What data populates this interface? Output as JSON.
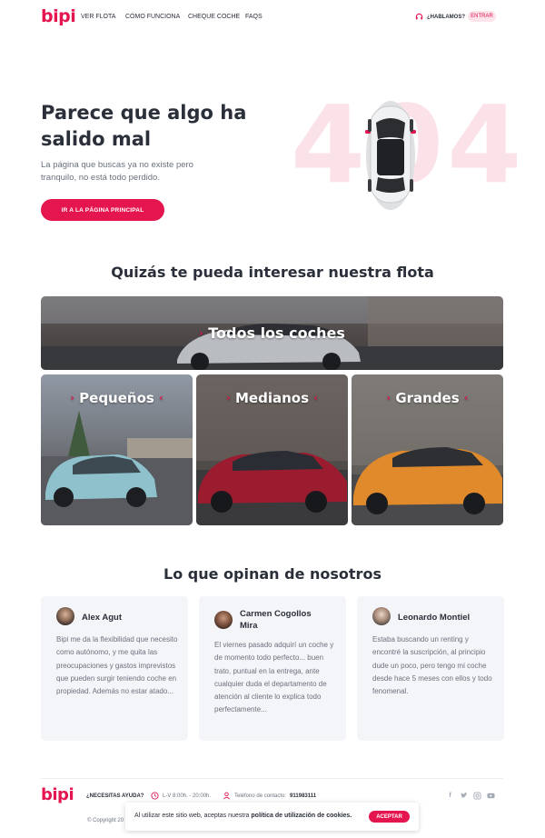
{
  "brand": {
    "logo": "bipi",
    "accent": "#e5154f",
    "accent_soft": "#fde3ea"
  },
  "header": {
    "nav": [
      "VER FLOTA",
      "CÓMO FUNCIONA",
      "CHEQUE COCHE",
      "FAQS"
    ],
    "contact_label": "¿HABLAMOS?",
    "login_label": "ENTRAR"
  },
  "hero": {
    "title": "Parece que algo ha salido mal",
    "subtitle": "La página que buscas ya no existe pero tranquilo, no está todo perdido.",
    "button": "IR A LA PÁGINA PRINCIPAL",
    "error_code": "404"
  },
  "fleet": {
    "title": "Quizás te pueda interesar nuestra flota",
    "tiles": [
      "Todos los coches",
      "Pequeños",
      "Medianos",
      "Grandes"
    ]
  },
  "reviews": {
    "title": "Lo que opinan de nosotros",
    "items": [
      {
        "name": "Alex Agut",
        "text": "Bipi me da la flexibilidad que necesito como autónomo, y me quita las preocupaciones y gastos imprevistos que pueden surgir teniendo coche en propiedad. Además no estar atado..."
      },
      {
        "name": "Carmen Cogollos Mira",
        "text": "El viernes pasado adquirí un coche y de momento todo perfecto... buen trato, puntual en la entrega, ante cualquier duda el departamento de atención al cliente lo explica todo perfectamente..."
      },
      {
        "name": "Leonardo Montiel",
        "text": "Estaba buscando un renting y encontré la suscripción, al principio dude un poco, pero tengo mi coche desde hace 5 meses con ellos y todo fenomenal."
      }
    ]
  },
  "footer": {
    "logo": "bipi",
    "help": "¿NECESITAS AYUDA?",
    "hours": "L-V 8:00h. - 20:00h.",
    "phone_label": "Teléfono de contacto:",
    "phone": "911983111",
    "copyright": "© Copyright 20",
    "socials": [
      "facebook-icon",
      "twitter-icon",
      "instagram-icon",
      "youtube-icon"
    ]
  },
  "cookie": {
    "text": "Al utilizar este sitio web, aceptas nuestra",
    "link": "política de utilización de cookies.",
    "button": "ACEPTAR"
  }
}
